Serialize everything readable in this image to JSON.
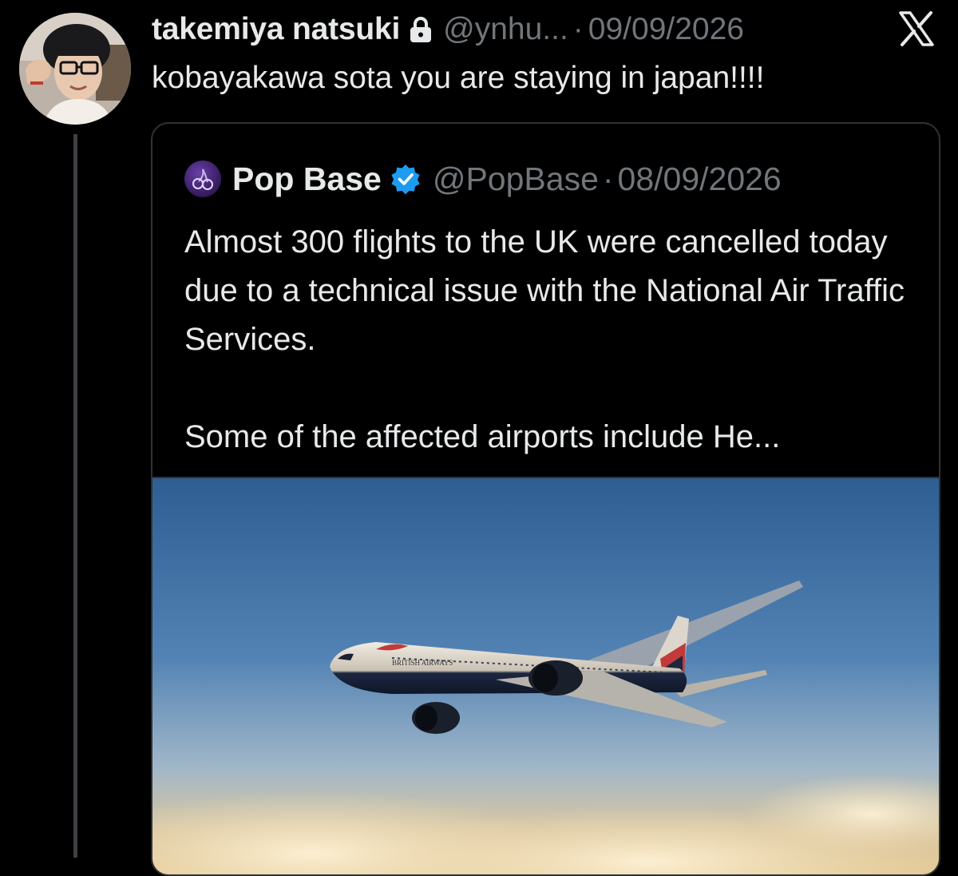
{
  "tweet": {
    "display_name": "takemiya natsuki",
    "handle": "@ynhu...",
    "separator": "·",
    "timestamp": "09/09/2026",
    "text": "kobayakawa sota you are staying in japan!!!!",
    "icons": {
      "lock": "lock-icon",
      "platform": "x-logo-icon",
      "avatar": "avatar"
    }
  },
  "quote": {
    "display_name": "Pop Base",
    "handle": "@PopBase",
    "separator": "·",
    "timestamp": "08/09/2026",
    "body": {
      "paragraph1": "Almost 300 flights to the UK were cancelled today due to a technical issue with the National Air Traffic Services.",
      "paragraph2": "Some of the affected airports include He..."
    },
    "image": {
      "airline_livery_text": "BRITISH AIRWAYS"
    },
    "icons": {
      "avatar": "cherry-icon",
      "verified": "verified-badge-icon"
    }
  },
  "colors": {
    "background": "#000000",
    "text_primary": "#e7e9ea",
    "text_secondary": "#71767b",
    "border": "#2f3336",
    "verified_blue": "#1d9bf0",
    "thread_line": "#3e4144"
  }
}
